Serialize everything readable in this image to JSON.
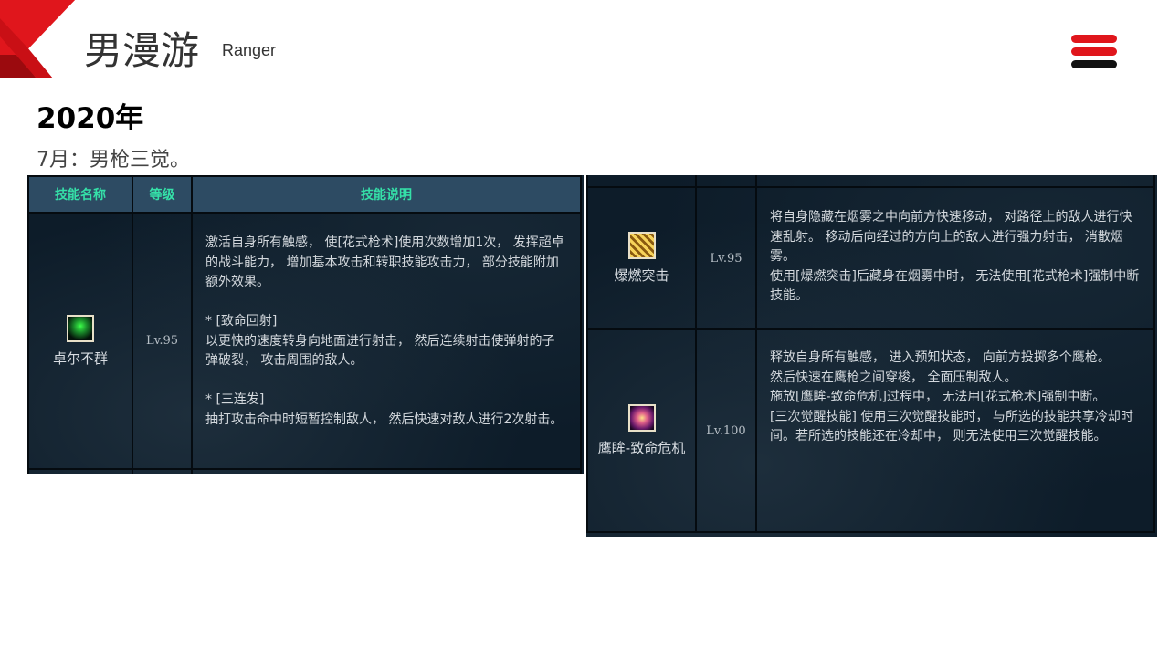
{
  "header": {
    "title": "男漫游",
    "subtitle": "Ranger"
  },
  "section": {
    "year": "2020年",
    "note": "7月：男枪三觉。"
  },
  "table_left": {
    "headers": [
      "技能名称",
      "等级",
      "技能说明"
    ],
    "row": {
      "name": "卓尔不群",
      "level": "Lv.95",
      "desc1": "激活自身所有触感， 使[花式枪术]使用次数增加1次， 发挥超卓的战斗能力， 增加基本攻击和转职技能攻击力， 部分技能附加额外效果。",
      "desc2": "* [致命回射]\n以更快的速度转身向地面进行射击， 然后连续射击使弹射的子弹破裂， 攻击周围的敌人。",
      "desc3": "* [三连发]\n抽打攻击命中时短暂控制敌人， 然后快速对敌人进行2次射击。"
    }
  },
  "table_right": {
    "rows": [
      {
        "name": "爆燃突击",
        "level": "Lv.95",
        "desc": "将自身隐藏在烟雾之中向前方快速移动， 对路径上的敌人进行快速乱射。 移动后向经过的方向上的敌人进行强力射击， 消散烟雾。\n使用[爆燃突击]后藏身在烟雾中时， 无法使用[花式枪术]强制中断技能。"
      },
      {
        "name": "鹰眸-致命危机",
        "level": "Lv.100",
        "desc": "释放自身所有触感， 进入预知状态， 向前方投掷多个鹰枪。\n然后快速在鹰枪之间穿梭， 全面压制敌人。\n施放[鹰眸-致命危机]过程中， 无法用[花式枪术]强制中断。\n[三次觉醒技能] 使用三次觉醒技能时， 与所选的技能共享冷却时间。若所选的技能还在冷却中， 则无法使用三次觉醒技能。"
      }
    ]
  },
  "colors": {
    "accent_red": "#e0161c",
    "dark_red": "#9b0a0e",
    "header_cell": "#2d4b63",
    "header_text": "#35e0a8",
    "panel_bg": "#0d1c29"
  },
  "icons": {
    "menu": "hamburger-menu-icon",
    "skill1": "green-figure-skill-icon",
    "skill2": "golden-swirl-skill-icon",
    "skill3": "eye-burst-skill-icon"
  }
}
